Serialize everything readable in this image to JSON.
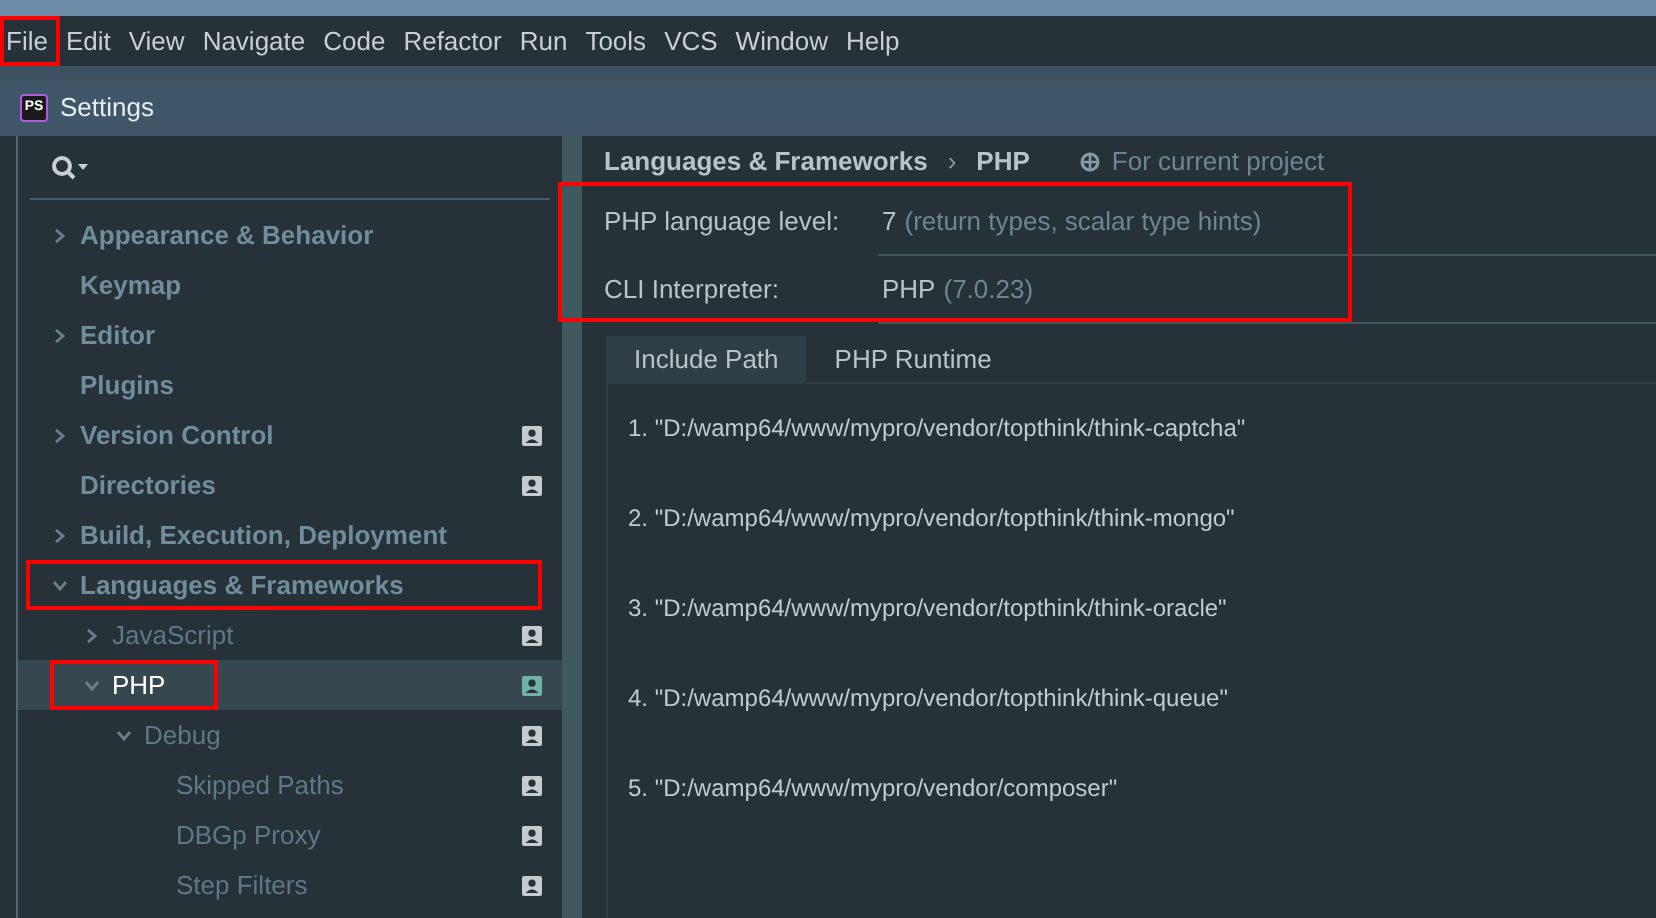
{
  "menu_bar": {
    "items": [
      {
        "label": "File",
        "highlighted": true
      },
      {
        "label": "Edit",
        "highlighted": false
      },
      {
        "label": "View",
        "highlighted": false
      },
      {
        "label": "Navigate",
        "highlighted": false
      },
      {
        "label": "Code",
        "highlighted": false
      },
      {
        "label": "Refactor",
        "highlighted": false
      },
      {
        "label": "Run",
        "highlighted": false
      },
      {
        "label": "Tools",
        "highlighted": false
      },
      {
        "label": "VCS",
        "highlighted": false
      },
      {
        "label": "Window",
        "highlighted": false
      },
      {
        "label": "Help",
        "highlighted": false
      }
    ]
  },
  "window": {
    "title": "Settings",
    "logo": "PS"
  },
  "sidebar": {
    "items": [
      {
        "kind": "group",
        "label": "Appearance & Behavior",
        "expanded": false,
        "project_level": false,
        "selected": false,
        "highlighted": false
      },
      {
        "kind": "leaf",
        "label": "Keymap",
        "project_level": false,
        "selected": false,
        "highlighted": false
      },
      {
        "kind": "group",
        "label": "Editor",
        "expanded": false,
        "project_level": false,
        "selected": false,
        "highlighted": false
      },
      {
        "kind": "leaf",
        "label": "Plugins",
        "project_level": false,
        "selected": false,
        "highlighted": false
      },
      {
        "kind": "group",
        "label": "Version Control",
        "expanded": false,
        "project_level": true,
        "selected": false,
        "highlighted": false
      },
      {
        "kind": "leaf",
        "label": "Directories",
        "project_level": true,
        "selected": false,
        "highlighted": false
      },
      {
        "kind": "group",
        "label": "Build, Execution, Deployment",
        "expanded": false,
        "project_level": false,
        "selected": false,
        "highlighted": false
      },
      {
        "kind": "group",
        "label": "Languages & Frameworks",
        "expanded": true,
        "project_level": false,
        "selected": false,
        "highlighted": true,
        "children": [
          {
            "kind": "group",
            "label": "JavaScript",
            "expanded": false,
            "project_level": true,
            "selected": false,
            "highlighted": false
          },
          {
            "kind": "group",
            "label": "PHP",
            "expanded": true,
            "project_level": true,
            "selected": true,
            "highlighted": true,
            "children": [
              {
                "kind": "group",
                "label": "Debug",
                "expanded": true,
                "project_level": true,
                "selected": false,
                "highlighted": false,
                "children": [
                  {
                    "kind": "leaf",
                    "label": "Skipped Paths",
                    "project_level": true,
                    "selected": false,
                    "highlighted": false
                  },
                  {
                    "kind": "leaf",
                    "label": "DBGp Proxy",
                    "project_level": true,
                    "selected": false,
                    "highlighted": false
                  },
                  {
                    "kind": "leaf",
                    "label": "Step Filters",
                    "project_level": true,
                    "selected": false,
                    "highlighted": false
                  }
                ]
              }
            ]
          }
        ]
      }
    ]
  },
  "breadcrumb": {
    "parent": "Languages & Frameworks",
    "separator": "›",
    "current": "PHP",
    "scope": "For current project"
  },
  "fields": {
    "highlighted": true,
    "rows": [
      {
        "label": "PHP language level:",
        "value": "7",
        "hint": "(return types, scalar type hints)"
      },
      {
        "label": "CLI Interpreter:",
        "value": "PHP",
        "hint": "(7.0.23)"
      }
    ]
  },
  "tabs": [
    {
      "label": "Include Path",
      "selected": true
    },
    {
      "label": "PHP Runtime",
      "selected": false
    }
  ],
  "include_paths": [
    "1. \"D:/wamp64/www/mypro/vendor/topthink/think-captcha\"",
    "2. \"D:/wamp64/www/mypro/vendor/topthink/think-mongo\"",
    "3. \"D:/wamp64/www/mypro/vendor/topthink/think-oracle\"",
    "4. \"D:/wamp64/www/mypro/vendor/topthink/think-queue\"",
    "5. \"D:/wamp64/www/mypro/vendor/composer\""
  ]
}
